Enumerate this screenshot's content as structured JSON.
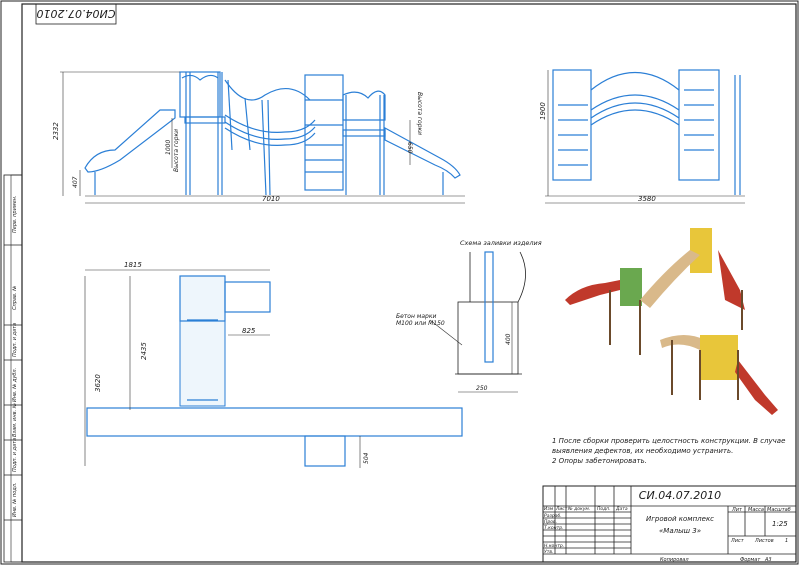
{
  "drawing": {
    "stamp_rotated": "СИ04.07.2010",
    "code": "СИ.04.07.2010",
    "title_line1": "Игровой комплекс",
    "title_line2": "«Малыш 3»",
    "scale": "1:25",
    "sheet_label": "Лист",
    "sheets_label": "Листов",
    "sheets_value": "1",
    "lit_label": "Лит",
    "mass_label": "Масса",
    "scale_label": "Масштаб",
    "copied": "Копировал",
    "format": "Формат",
    "format_value": "A3"
  },
  "titleblock": {
    "col_headers": [
      "Изм",
      "Лист",
      "№ докум.",
      "Подп.",
      "Дата"
    ],
    "rows": [
      "Разраб.",
      "Пров.",
      "Т.контр.",
      "",
      "Н.контр.",
      "Утв."
    ]
  },
  "side_strip": [
    "Перв. примен.",
    "Справ. №",
    "Подп. и дата",
    "Инв. № дубл.",
    "Взам. инв. №",
    "Подп. и дата",
    "Инв. № подл."
  ],
  "dimensions": {
    "front_height": "2332",
    "front_width": "7010",
    "front_base": "407",
    "front_slide1": "1000",
    "front_slide1_note": "Высота горки",
    "front_slide2": "650",
    "front_slide2_note": "Высота горки",
    "side_height": "1900",
    "side_width": "3580",
    "plan_top": "1815",
    "plan_mid": "2435",
    "plan_full": "3620",
    "plan_inner": "825",
    "plan_bottom": "504",
    "detail_depth": "400",
    "detail_width": "250"
  },
  "detail": {
    "title": "Схема заливки изделия",
    "concrete_line1": "Бетон марки",
    "concrete_line2": "М100 или М150"
  },
  "notes": {
    "line1": "1 После сборки проверить целостность конструкции. В случае",
    "line2": "выявления дефектов, их необходимо устранить.",
    "line3": "2 Опоры забетонировать."
  },
  "colors": {
    "line": "#2b7fd6",
    "frame": "#222222",
    "slide_red": "#c0392b",
    "panel_yellow": "#e8c63a",
    "panel_green": "#6aa84f"
  }
}
